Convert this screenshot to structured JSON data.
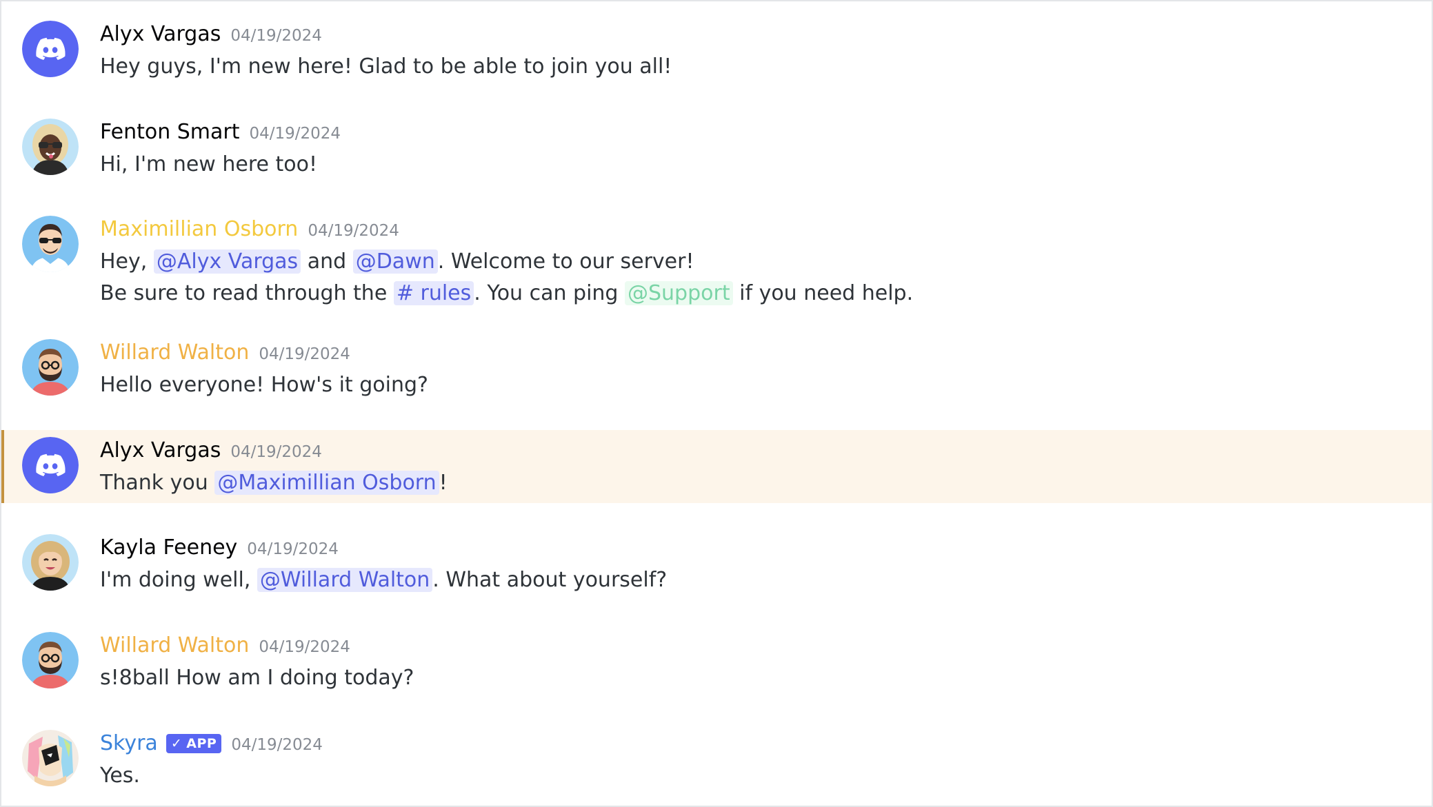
{
  "colors": {
    "discord_blurple": "#5865f2",
    "mention_text": "#505cdc",
    "mention_bg": "#e6e8fd",
    "role_support": "#7ad4a6",
    "highlight_bg": "#fdf5ea",
    "highlight_bar": "#c4923f",
    "name_default": "#060607",
    "name_maximillian": "#f3c93e",
    "name_willard": "#f0b145",
    "name_skyra": "#3b83da",
    "timestamp": "#868b93"
  },
  "messages": [
    {
      "author": "Alyx Vargas",
      "name_color": "#060607",
      "timestamp": "04/19/2024",
      "avatar_icon": "discord-logo-icon",
      "lines": [
        "Hey guys, I'm new here! Glad to be able to join you all!"
      ]
    },
    {
      "author": "Fenton Smart",
      "name_color": "#060607",
      "timestamp": "04/19/2024",
      "avatar_icon": "sunglasses-person-avatar",
      "lines": [
        "Hi, I'm new here too!"
      ]
    },
    {
      "author": "Maximillian Osborn",
      "name_color": "#f3c93e",
      "timestamp": "04/19/2024",
      "avatar_icon": "sunglasses-man-avatar",
      "line1": {
        "t1": "Hey, ",
        "mention1": "@Alyx Vargas",
        "t2": " and ",
        "mention2": "@Dawn",
        "t3": ". Welcome to our server!"
      },
      "line2": {
        "t1": "Be sure to read through the ",
        "channel": "# rules",
        "t2": ". You can ping ",
        "role": "@Support",
        "t3": " if you need help."
      }
    },
    {
      "author": "Willard Walton",
      "name_color": "#f0b145",
      "timestamp": "04/19/2024",
      "avatar_icon": "bearded-man-avatar",
      "lines": [
        "Hello everyone! How's it going?"
      ]
    },
    {
      "author": "Alyx Vargas",
      "name_color": "#060607",
      "timestamp": "04/19/2024",
      "avatar_icon": "discord-logo-icon",
      "highlighted": true,
      "line1": {
        "t1": "Thank you ",
        "mention1": "@Maximillian Osborn",
        "t2": "!"
      }
    },
    {
      "author": "Kayla Feeney",
      "name_color": "#060607",
      "timestamp": "04/19/2024",
      "avatar_icon": "blonde-woman-avatar",
      "line1": {
        "t1": "I'm doing well, ",
        "mention1": "@Willard Walton",
        "t2": ". What about yourself?"
      }
    },
    {
      "author": "Willard Walton",
      "name_color": "#f0b145",
      "timestamp": "04/19/2024",
      "avatar_icon": "bearded-man-avatar",
      "lines": [
        "s!8ball How am I doing today?"
      ]
    },
    {
      "author": "Skyra",
      "name_color": "#3b83da",
      "badge": "APP",
      "badge_icon": "checkmark-icon",
      "timestamp": "04/19/2024",
      "avatar_icon": "skyra-anime-avatar",
      "lines": [
        "Yes."
      ]
    }
  ]
}
